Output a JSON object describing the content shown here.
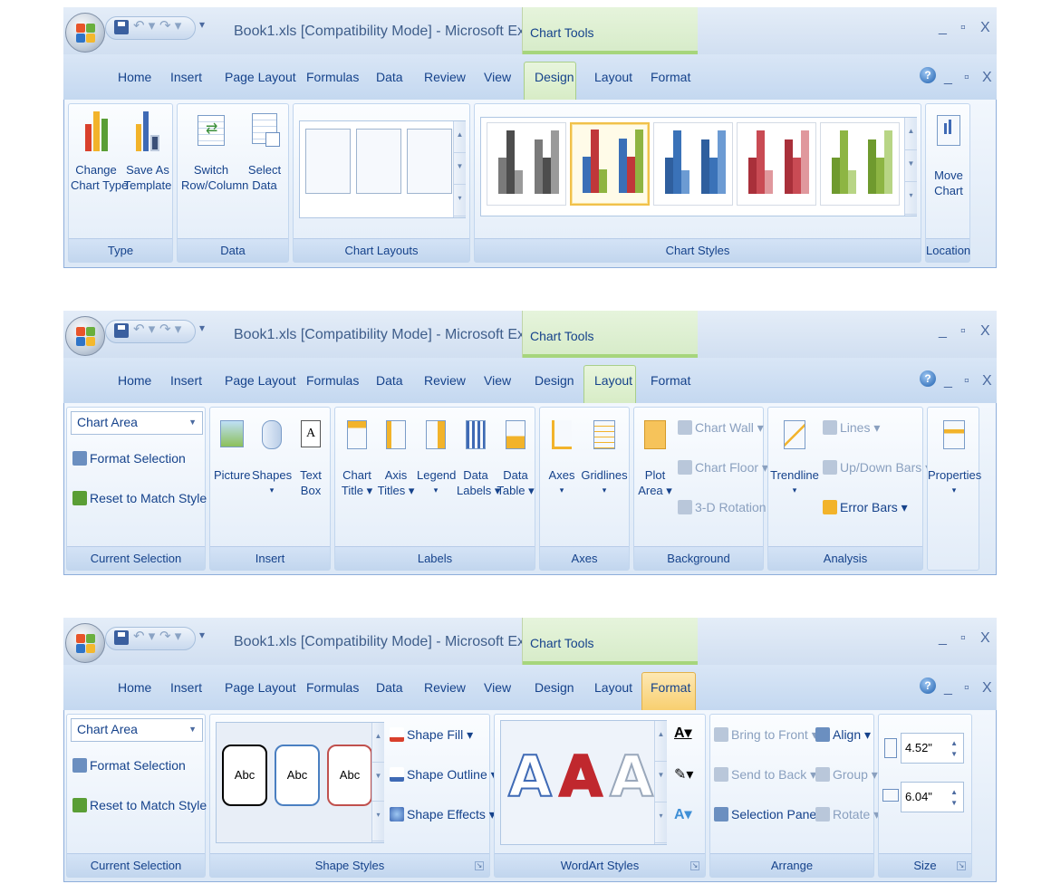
{
  "title_bar": {
    "document_title": "Book1.xls  [Compatibility Mode] - Microsoft Ex...",
    "contextual_group": "Chart Tools",
    "minimize": "_",
    "restore": "▫",
    "close": "X"
  },
  "tabs": [
    "Home",
    "Insert",
    "Page Layout",
    "Formulas",
    "Data",
    "Review",
    "View",
    "Design",
    "Layout",
    "Format"
  ],
  "help_icon": "?",
  "design_ribbon": {
    "active_tab": "Design",
    "groups": {
      "type": {
        "label": "Type",
        "buttons": [
          {
            "line1": "Change",
            "line2": "Chart Type"
          },
          {
            "line1": "Save As",
            "line2": "Template"
          }
        ]
      },
      "data": {
        "label": "Data",
        "buttons": [
          {
            "line1": "Switch",
            "line2": "Row/Column"
          },
          {
            "line1": "Select",
            "line2": "Data"
          }
        ]
      },
      "chart_layouts": {
        "label": "Chart Layouts"
      },
      "chart_styles": {
        "label": "Chart Styles",
        "selected_index": 1,
        "styles": [
          {
            "colors": [
              "#7a7a7a",
              "#4d4d4d",
              "#9a9a9a"
            ]
          },
          {
            "colors": [
              "#3a6fb7",
              "#c0373a",
              "#8fb441"
            ]
          },
          {
            "colors": [
              "#2f5f9e",
              "#3a72b8",
              "#6c9bd3"
            ]
          },
          {
            "colors": [
              "#a9303a",
              "#c94b54",
              "#e0989d"
            ]
          },
          {
            "colors": [
              "#6f9a2e",
              "#8db543",
              "#b8d585"
            ]
          }
        ]
      },
      "location": {
        "label": "Location",
        "buttons": [
          {
            "line1": "Move",
            "line2": "Chart"
          }
        ]
      }
    }
  },
  "layout_ribbon": {
    "active_tab": "Layout",
    "current_selection": {
      "label": "Current Selection",
      "dropdown_value": "Chart Area",
      "format_selection": "Format Selection",
      "reset_style": "Reset to Match Style"
    },
    "insert": {
      "label": "Insert",
      "buttons": [
        {
          "line1": "Picture",
          "line2": ""
        },
        {
          "line1": "Shapes",
          "line2": "▾"
        },
        {
          "line1": "Text",
          "line2": "Box"
        }
      ]
    },
    "labels": {
      "label": "Labels",
      "buttons": [
        {
          "line1": "Chart",
          "line2": "Title ▾"
        },
        {
          "line1": "Axis",
          "line2": "Titles ▾"
        },
        {
          "line1": "Legend",
          "line2": "▾"
        },
        {
          "line1": "Data",
          "line2": "Labels ▾"
        },
        {
          "line1": "Data",
          "line2": "Table ▾"
        }
      ]
    },
    "axes": {
      "label": "Axes",
      "buttons": [
        {
          "line1": "Axes",
          "line2": "▾"
        },
        {
          "line1": "Gridlines",
          "line2": "▾"
        }
      ]
    },
    "background": {
      "label": "Background",
      "plot_area": {
        "line1": "Plot",
        "line2": "Area ▾"
      },
      "chart_wall": "Chart Wall ▾",
      "chart_floor": "Chart Floor ▾",
      "rotation": "3-D Rotation"
    },
    "analysis": {
      "label": "Analysis",
      "trendline": {
        "line1": "Trendline",
        "line2": "▾"
      },
      "lines": "Lines ▾",
      "updown": "Up/Down Bars ▾",
      "error_bars": "Error Bars ▾"
    },
    "properties": {
      "line1": "Properties",
      "line2": "▾"
    }
  },
  "format_ribbon": {
    "active_tab": "Format",
    "current_selection": {
      "label": "Current Selection",
      "dropdown_value": "Chart Area",
      "format_selection": "Format Selection",
      "reset_style": "Reset to Match Style"
    },
    "shape_styles": {
      "label": "Shape Styles",
      "thumb_text": "Abc",
      "thumb_colors": [
        "#000000",
        "#4a7fc1",
        "#c0504d"
      ],
      "shape_fill": "Shape Fill ▾",
      "shape_outline": "Shape Outline ▾",
      "shape_effects": "Shape Effects ▾"
    },
    "wordart_styles": {
      "label": "WordArt Styles",
      "letter": "A",
      "letter_colors": [
        "#ffffff",
        "#c0282e",
        "#ffffff"
      ]
    },
    "arrange": {
      "label": "Arrange",
      "bring_to_front": "Bring to Front ▾",
      "send_to_back": "Send to Back ▾",
      "selection_pane": "Selection Pane",
      "align": "Align ▾",
      "group": "Group ▾",
      "rotate": "Rotate ▾"
    },
    "size": {
      "label": "Size",
      "height": "4.52\"",
      "width": "6.04\""
    }
  }
}
